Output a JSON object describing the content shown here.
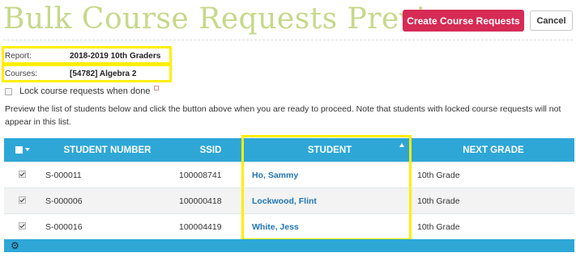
{
  "header": {
    "title": "Bulk Course Requests Preview",
    "create_label": "Create Course Requests",
    "cancel_label": "Cancel"
  },
  "report": {
    "label": "Report:",
    "value": "2018-2019 10th Graders"
  },
  "courses": {
    "label": "Courses:",
    "value": "[54782] Algebra 2"
  },
  "lock_option": {
    "label": "Lock course requests when done",
    "checked": false
  },
  "description": "Preview the list of students below and click the button above when you are ready to proceed. Note that students with locked course requests will not appear in this list.",
  "table": {
    "columns": [
      "STUDENT NUMBER",
      "SSID",
      "STUDENT",
      "NEXT GRADE"
    ],
    "sorted_column": "STUDENT",
    "sort_direction": "ascending",
    "rows": [
      {
        "checked": true,
        "student_number": "S-000011",
        "ssid": "100008741",
        "student": "Ho, Sammy",
        "next_grade": "10th Grade"
      },
      {
        "checked": true,
        "student_number": "S-000006",
        "ssid": "100000418",
        "student": "Lockwood, Flint",
        "next_grade": "10th Grade"
      },
      {
        "checked": true,
        "student_number": "S-000016",
        "ssid": "100004419",
        "student": "White, Jess",
        "next_grade": "10th Grade"
      }
    ]
  },
  "colors": {
    "title": "#c5d98a",
    "primary_button": "#d52b55",
    "table_header": "#2ea7d7",
    "link": "#2176b5",
    "highlight": "#ffee00"
  },
  "icons": [
    "select-all-checkbox",
    "chevron-down-icon",
    "sort-ascending-icon",
    "help-icon",
    "gear-icon"
  ]
}
